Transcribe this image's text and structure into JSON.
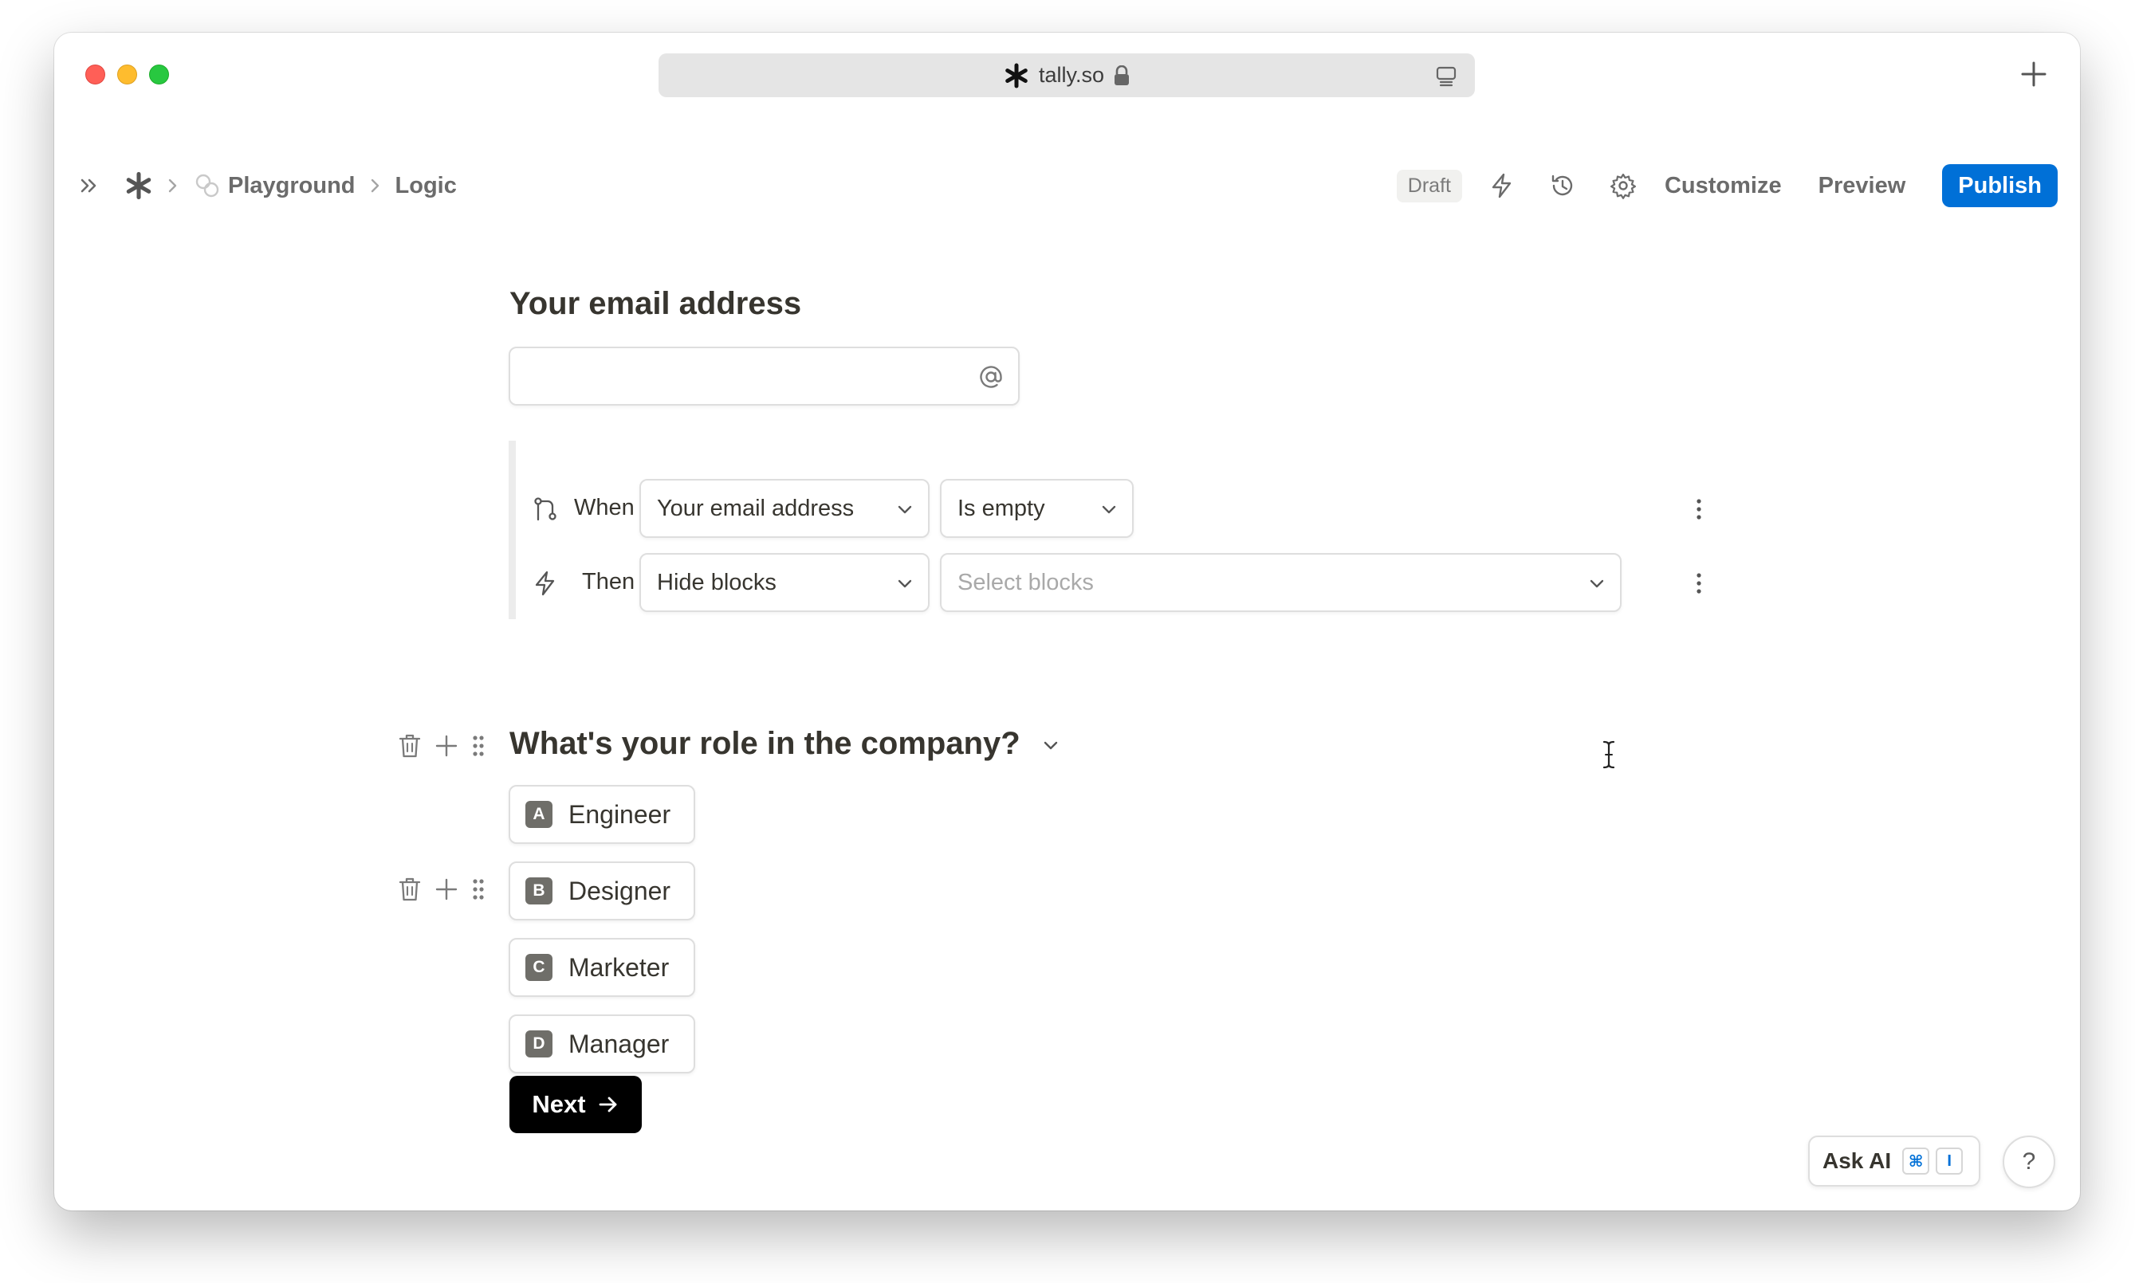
{
  "browser": {
    "url": "tally.so"
  },
  "toolbar": {
    "breadcrumbs": [
      "Playground",
      "Logic"
    ],
    "status_badge": "Draft",
    "customize_label": "Customize",
    "preview_label": "Preview",
    "publish_label": "Publish",
    "accent_color": "#0070d7"
  },
  "form": {
    "email_question": {
      "title": "Your email address",
      "value": "",
      "icon": "at-icon"
    },
    "logic": {
      "when_label": "When",
      "when_field": "Your email address",
      "when_condition": "Is empty",
      "then_label": "Then",
      "then_action": "Hide blocks",
      "then_target_placeholder": "Select blocks"
    },
    "role_question": {
      "title": "What's your role in the company?",
      "options": [
        {
          "key": "A",
          "label": "Engineer"
        },
        {
          "key": "B",
          "label": "Designer"
        },
        {
          "key": "C",
          "label": "Marketer"
        },
        {
          "key": "D",
          "label": "Manager"
        }
      ]
    },
    "next_label": "Next"
  },
  "assistant": {
    "ask_ai_label": "Ask AI",
    "shortcut_keys": [
      "⌘",
      "I"
    ],
    "help_label": "?"
  }
}
